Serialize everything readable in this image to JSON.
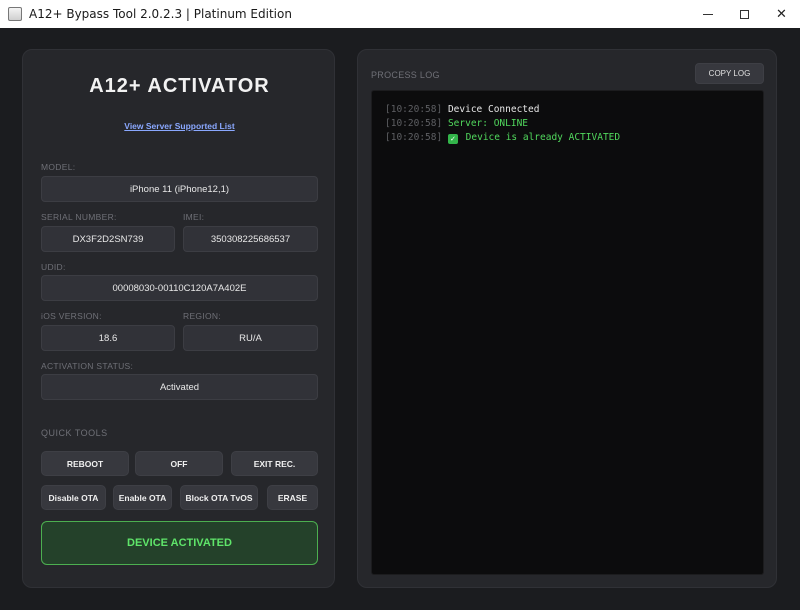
{
  "window": {
    "title": "A12+ Bypass Tool 2.0.2.3 | Platinum Edition",
    "controls": {
      "minimize": "minimize-icon",
      "maximize": "maximize-icon",
      "close": "✕"
    }
  },
  "left": {
    "heading": "A12+ ACTIVATOR",
    "server_link": "View Server Supported List",
    "model": {
      "label": "MODEL:",
      "value": "iPhone 11 (iPhone12,1)"
    },
    "serial": {
      "label": "SERIAL NUMBER:",
      "value": "DX3F2D2SN739"
    },
    "imei": {
      "label": "IMEI:",
      "value": "350308225686537"
    },
    "udid": {
      "label": "UDID:",
      "value": "00008030-00110C120A7A402E"
    },
    "ios": {
      "label": "iOS VERSION:",
      "value": "18.6"
    },
    "region": {
      "label": "REGION:",
      "value": "RU/A"
    },
    "activation": {
      "label": "ACTIVATION STATUS:",
      "value": "Activated"
    },
    "quick_tools": {
      "label": "QUICK TOOLS",
      "reboot": "REBOOT",
      "off": "OFF",
      "exit_rec": "EXIT REC.",
      "disable_ota": "Disable OTA",
      "enable_ota": "Enable OTA",
      "block_ota_tvos": "Block OTA TvOS",
      "erase": "ERASE"
    },
    "status_button": "DEVICE ACTIVATED"
  },
  "log": {
    "title": "PROCESS LOG",
    "copy_button": "COPY LOG",
    "lines": [
      {
        "time": "[10:20:58]",
        "text": "Device Connected"
      },
      {
        "time": "[10:20:58]",
        "text": "Server: ONLINE"
      },
      {
        "time": "[10:20:58]",
        "icon": "✓",
        "text": "Device is already ACTIVATED"
      }
    ]
  },
  "colors": {
    "background": "#1b1c1f",
    "panel": "#26272b",
    "accent_green": "#51d85d",
    "link_blue": "#8aa8ff"
  }
}
